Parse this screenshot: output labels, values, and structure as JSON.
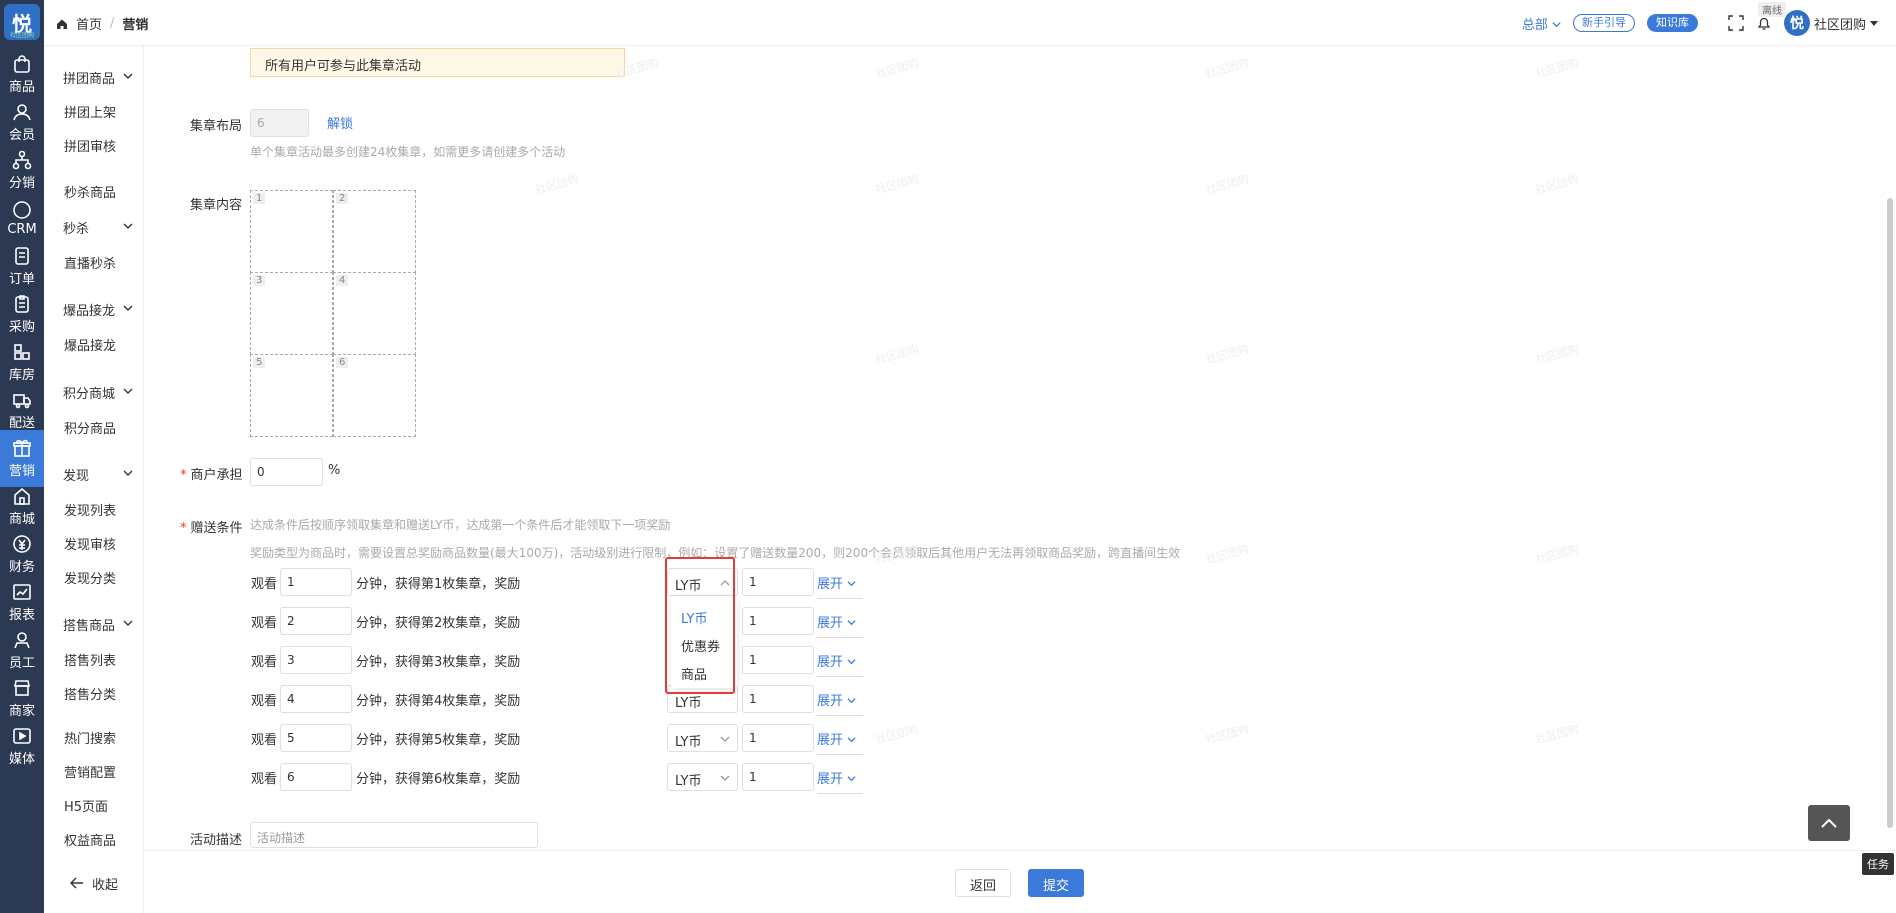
{
  "rail": {
    "logo": "悦",
    "logo_sub": "社区团购",
    "items": [
      "商品",
      "会员",
      "分销",
      "CRM",
      "订单",
      "采购",
      "库房",
      "配送",
      "营销",
      "商城",
      "财务",
      "报表",
      "员工",
      "商家",
      "媒体"
    ],
    "crm_badge": "CRM"
  },
  "submenu": {
    "g1": "拼团商品",
    "l1": "拼团上架",
    "l2": "拼团审核",
    "l3": "秒杀商品",
    "g2": "秒杀",
    "l4": "直播秒杀",
    "g3": "爆品接龙",
    "l5": "爆品接龙",
    "g4": "积分商城",
    "l6": "积分商品",
    "g5": "发现",
    "l7": "发现列表",
    "l8": "发现审核",
    "l9": "发现分类",
    "g6": "搭售商品",
    "l10": "搭售列表",
    "l11": "搭售分类",
    "l12": "热门搜索",
    "l13": "营销配置",
    "l14": "H5页面",
    "l15": "权益商品",
    "collapse": "收起"
  },
  "topbar": {
    "home": "首页",
    "current": "营销",
    "hq": "总部",
    "guide": "新手引导",
    "kb": "知识库",
    "offline": "离线",
    "user": "社区团购"
  },
  "form": {
    "notice": "所有用户可参与此集章活动",
    "layout_label": "集章布局",
    "layout_value": "6",
    "unlock": "解锁",
    "layout_hint": "单个集章活动最多创建24枚集章，如需更多请创建多个活动",
    "content_label": "集章内容",
    "cells": [
      "1",
      "2",
      "3",
      "4",
      "5",
      "6"
    ],
    "merchant_label": "商户承担",
    "merchant_value": "0",
    "percent": "%",
    "gift_label": "赠送条件",
    "gift_hint1": "达成条件后按顺序领取集章和赠送LY币，达成第一个条件后才能领取下一项奖励",
    "gift_hint2": "奖励类型为商品时，需要设置总奖励商品数量(最大100万)，活动级别进行限制，例如：设置了赠送数量200，则200个会员领取后其他用户无法再领取商品奖励，跨直播间生效",
    "watch": "观看",
    "rows": [
      {
        "min": "1",
        "text": "分钟，获得第1枚集章，奖励",
        "type": "LY币",
        "qty": "1"
      },
      {
        "min": "2",
        "text": "分钟，获得第2枚集章，奖励",
        "type": "LY币",
        "qty": "1"
      },
      {
        "min": "3",
        "text": "分钟，获得第3枚集章，奖励",
        "type": "LY币",
        "qty": "1"
      },
      {
        "min": "4",
        "text": "分钟，获得第4枚集章，奖励",
        "type": "LY币",
        "qty": "1"
      },
      {
        "min": "5",
        "text": "分钟，获得第5枚集章，奖励",
        "type": "LY币",
        "qty": "1"
      },
      {
        "min": "6",
        "text": "分钟，获得第6枚集章，奖励",
        "type": "LY币",
        "qty": "1"
      }
    ],
    "expand": "展开",
    "dropdown": [
      "LY币",
      "优惠券",
      "商品"
    ],
    "desc_label": "活动描述",
    "desc_placeholder": "活动描述"
  },
  "bottom": {
    "back": "返回",
    "submit": "提交"
  },
  "task": "任务",
  "watermark": "社区团购",
  "colors": {
    "primary": "#3b7ad9",
    "rail": "#2b3a52",
    "danger": "#e23b3b"
  }
}
